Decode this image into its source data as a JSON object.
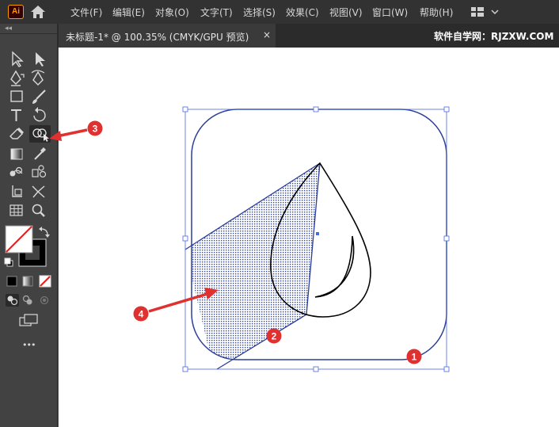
{
  "app": {
    "logo": "Ai"
  },
  "menubar": {
    "items": [
      "文件(F)",
      "编辑(E)",
      "对象(O)",
      "文字(T)",
      "选择(S)",
      "效果(C)",
      "视图(V)",
      "窗口(W)",
      "帮助(H)"
    ]
  },
  "document": {
    "tab_title": "未标题-1* @ 100.35% (CMYK/GPU 预览)",
    "close_symbol": "×"
  },
  "brand": {
    "text": "软件自学网：RJZXW.COM"
  },
  "toolbar": {
    "collapse_symbol": "◂◂",
    "tools": [
      [
        "selection-tool-icon",
        "direct-selection-tool-icon"
      ],
      [
        "pen-tool-icon",
        "curvature-tool-icon"
      ],
      [
        "rectangle-tool-icon",
        "paintbrush-tool-icon"
      ],
      [
        "type-tool-icon",
        "rotate-tool-icon"
      ],
      [
        "eraser-tool-icon",
        "shape-builder-tool-icon"
      ],
      [
        "gradient-tool-icon",
        "eyedropper-tool-icon"
      ],
      [
        "blend-tool-icon",
        "symbol-sprayer-tool-icon"
      ],
      [
        "artboard-tool-icon",
        "perspective-grid-tool-icon"
      ],
      [
        "mesh-tool-icon",
        "zoom-tool-icon"
      ]
    ],
    "active_tool": "shape-builder-tool-icon",
    "fill": "none",
    "stroke": "#000000",
    "more_symbol": "•••"
  },
  "annotations": [
    {
      "label": "1"
    },
    {
      "label": "2"
    },
    {
      "label": "3"
    },
    {
      "label": "4"
    }
  ],
  "colors": {
    "menubar_bg": "#323232",
    "toolbar_bg": "#424242",
    "canvas_bg": "#ffffff",
    "selection_blue": "#2c3f97",
    "annotation_red": "#e03030"
  }
}
